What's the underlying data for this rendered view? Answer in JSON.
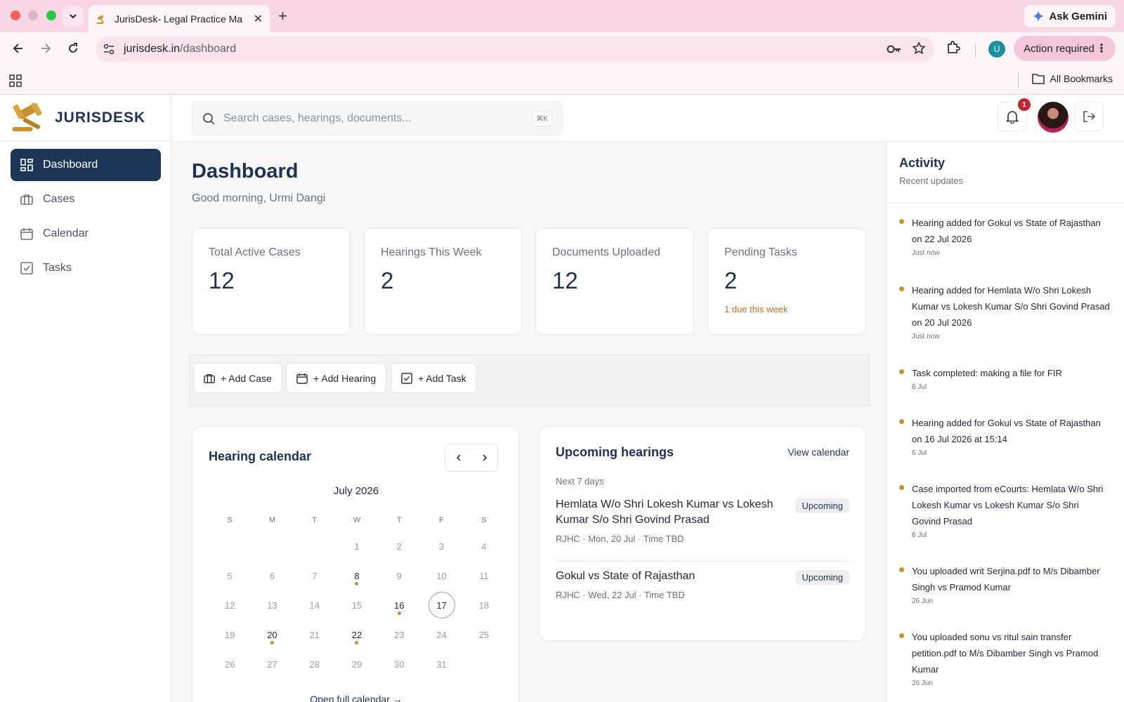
{
  "browser": {
    "tab_title": "JurisDesk- Legal Practice Ma",
    "ask_gemini": "Ask Gemini",
    "url_host": "jurisdesk.in",
    "url_path": "/dashboard",
    "profile_initial": "U",
    "action_required": "Action required",
    "all_bookmarks": "All Bookmarks"
  },
  "brand": {
    "name": "JURISDESK"
  },
  "sidebar": {
    "items": [
      {
        "label": "Dashboard",
        "icon": "dashboard-grid-icon",
        "active": true
      },
      {
        "label": "Cases",
        "icon": "briefcase-icon",
        "active": false
      },
      {
        "label": "Calendar",
        "icon": "calendar-icon",
        "active": false
      },
      {
        "label": "Tasks",
        "icon": "checkbox-icon",
        "active": false
      }
    ]
  },
  "topbar": {
    "search_placeholder": "Search cases, hearings, documents...",
    "search_shortcut": "⌘K",
    "notification_count": "1"
  },
  "main": {
    "title": "Dashboard",
    "greeting": "Good morning, Urmi Dangi",
    "stats": [
      {
        "label": "Total Active Cases",
        "value": "12",
        "note": ""
      },
      {
        "label": "Hearings This Week",
        "value": "2",
        "note": ""
      },
      {
        "label": "Documents Uploaded",
        "value": "12",
        "note": ""
      },
      {
        "label": "Pending Tasks",
        "value": "2",
        "note": "1 due this week"
      }
    ],
    "quick_actions": [
      "+ Add Case",
      "+ Add Hearing",
      "+ Add Task"
    ]
  },
  "calendar": {
    "title": "Hearing calendar",
    "month": "July 2026",
    "weekdays": [
      "S",
      "M",
      "T",
      "W",
      "T",
      "F",
      "S"
    ],
    "weeks": [
      [
        "",
        "",
        "",
        "1",
        "2",
        "3",
        "4"
      ],
      [
        "5",
        "6",
        "7",
        "8",
        "9",
        "10",
        "11"
      ],
      [
        "12",
        "13",
        "14",
        "15",
        "16",
        "17",
        "18"
      ],
      [
        "19",
        "20",
        "21",
        "22",
        "23",
        "24",
        "25"
      ],
      [
        "26",
        "27",
        "28",
        "29",
        "30",
        "31",
        ""
      ]
    ],
    "event_days": [
      "8",
      "16",
      "20",
      "22"
    ],
    "today": "17",
    "open_full": "Open full calendar →"
  },
  "upcoming": {
    "title": "Upcoming hearings",
    "view_calendar": "View calendar",
    "range": "Next 7 days",
    "items": [
      {
        "title": "Hemlata W/o Shri Lokesh Kumar vs Lokesh Kumar S/o Shri Govind Prasad",
        "meta": "RJHC · Mon, 20 Jul · Time TBD",
        "status": "Upcoming"
      },
      {
        "title": "Gokul vs State of Rajasthan",
        "meta": "RJHC · Wed, 22 Jul · Time TBD",
        "status": "Upcoming"
      }
    ]
  },
  "activity": {
    "title": "Activity",
    "subtitle": "Recent updates",
    "items": [
      {
        "text": "Hearing added for Gokul vs State of Rajasthan on 22 Jul 2026",
        "time": "Just now"
      },
      {
        "text": "Hearing added for Hemlata W/o Shri Lokesh Kumar vs Lokesh Kumar S/o Shri Govind Prasad on 20 Jul 2026",
        "time": "Just now"
      },
      {
        "text": "Task completed: making a file for FIR",
        "time": "6 Jul"
      },
      {
        "text": "Hearing added for Gokul vs State of Rajasthan on 16 Jul 2026 at 15:14",
        "time": "6 Jul"
      },
      {
        "text": "Case imported from eCourts: Hemlata W/o Shri Lokesh Kumar vs Lokesh Kumar S/o Shri Govind Prasad",
        "time": "6 Jul"
      },
      {
        "text": "You uploaded writ Serjina.pdf to M/s Dibamber Singh vs Pramod Kumar",
        "time": "26 Jun"
      },
      {
        "text": "You uploaded sonu vs ritul sain transfer petition.pdf to M/s Dibamber Singh vs Pramod Kumar",
        "time": "26 Jun"
      }
    ]
  },
  "colors": {
    "primary": "#1d3557",
    "accent": "#c8902f",
    "danger": "#c0262d"
  }
}
